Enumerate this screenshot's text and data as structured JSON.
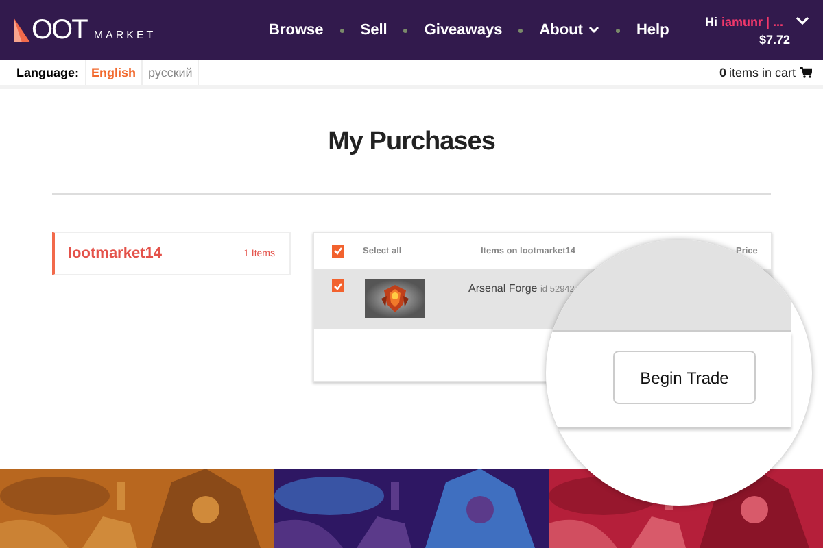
{
  "header": {
    "logo": "OOT",
    "logo_sub": "MARKET",
    "nav": [
      {
        "label": "Browse",
        "dropdown": false
      },
      {
        "label": "Sell",
        "dropdown": false
      },
      {
        "label": "Giveaways",
        "dropdown": false
      },
      {
        "label": "About",
        "dropdown": true
      },
      {
        "label": "Help",
        "dropdown": false
      }
    ],
    "greeting": "Hi",
    "username": "iamunr | ...",
    "balance": "$7.72"
  },
  "subbar": {
    "language_label": "Language:",
    "languages": [
      {
        "label": "English",
        "selected": true
      },
      {
        "label": "русский",
        "selected": false
      }
    ],
    "cart_count": "0",
    "cart_label": "items in cart"
  },
  "title": "My Purchases",
  "sellers": [
    {
      "name": "lootmarket14",
      "count": "1 Items",
      "selected": true
    }
  ],
  "table": {
    "select_all": "Select all",
    "select_all_checked": true,
    "items_heading": "Items on lootmarket14",
    "price_heading": "Price",
    "rows": [
      {
        "name": "Arsenal Forge",
        "id": "id 52942",
        "checked": true
      }
    ]
  },
  "magnifier": {
    "button": "Begin Trade"
  }
}
